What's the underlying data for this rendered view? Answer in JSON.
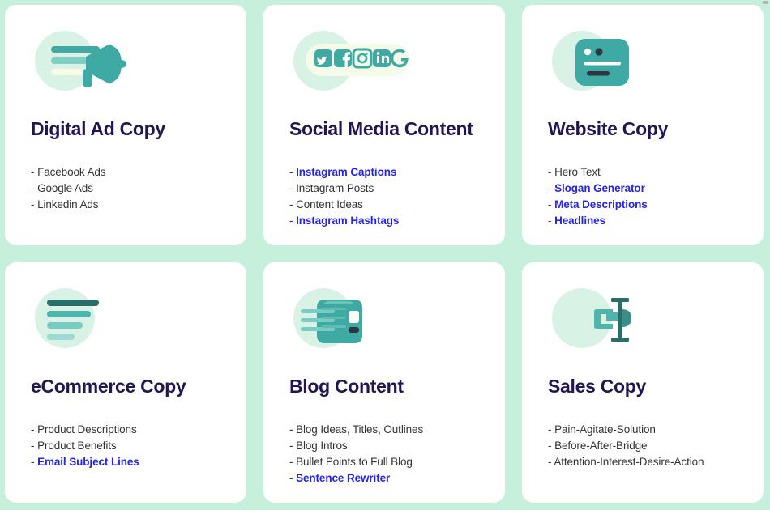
{
  "theme": {
    "background": "#c6f0dc",
    "card_background": "#ffffff",
    "title_color": "#231553",
    "text_color": "#333333",
    "link_color": "#2424ec",
    "icon_teal": "#3faaa4",
    "icon_teal_light": "#7fcfc6",
    "icon_teal_dark": "#2b6d68",
    "icon_blob": "#d8f2e6"
  },
  "cards": [
    {
      "id": "digital-ad-copy",
      "icon": "megaphone-icon",
      "title": "Digital Ad Copy",
      "items": [
        {
          "dash": "-",
          "label": "Facebook Ads",
          "link": false
        },
        {
          "dash": "-",
          "label": "Google Ads",
          "link": false
        },
        {
          "dash": "-",
          "label": "Linkedin Ads",
          "link": false
        }
      ]
    },
    {
      "id": "social-media-content",
      "icon": "social-networks-icon",
      "title": "Social Media Content",
      "social_icons": [
        "twitter-icon",
        "facebook-icon",
        "instagram-icon",
        "linkedin-icon",
        "google-icon"
      ],
      "items": [
        {
          "dash": "-",
          "label": "Instagram Captions",
          "link": true
        },
        {
          "dash": "-",
          "label": "Instagram Posts",
          "link": false
        },
        {
          "dash": "-",
          "label": "Content Ideas",
          "link": false
        },
        {
          "dash": "-",
          "label": "Instagram Hashtags",
          "link": true
        }
      ]
    },
    {
      "id": "website-copy",
      "icon": "browser-window-icon",
      "title": "Website Copy",
      "items": [
        {
          "dash": "-",
          "label": "Hero Text",
          "link": false
        },
        {
          "dash": "-",
          "label": "Slogan Generator",
          "link": true
        },
        {
          "dash": "-",
          "label": "Meta Descriptions",
          "link": true
        },
        {
          "dash": "-",
          "label": "Headlines",
          "link": true
        }
      ]
    },
    {
      "id": "ecommerce-copy",
      "icon": "text-lines-icon",
      "title": "eCommerce Copy",
      "items": [
        {
          "dash": "-",
          "label": "Product Descriptions",
          "link": false
        },
        {
          "dash": "-",
          "label": "Product Benefits",
          "link": false
        },
        {
          "dash": "-",
          "label": "Email Subject Lines",
          "link": true
        }
      ]
    },
    {
      "id": "blog-content",
      "icon": "article-card-icon",
      "title": "Blog Content",
      "items": [
        {
          "dash": "-",
          "label": "Blog Ideas, Titles, Outlines",
          "link": false
        },
        {
          "dash": "-",
          "label": "Blog Intros",
          "link": false
        },
        {
          "dash": "-",
          "label": "Bullet Points to Full Blog",
          "link": false
        },
        {
          "dash": "-",
          "label": "Sentence Rewriter",
          "link": true
        }
      ]
    },
    {
      "id": "sales-copy",
      "icon": "sales-funnel-icon",
      "title": "Sales Copy",
      "items": [
        {
          "dash": "-",
          "label": "Pain-Agitate-Solution",
          "link": false
        },
        {
          "dash": "-",
          "label": "Before-After-Bridge",
          "link": false
        },
        {
          "dash": "-",
          "label": "Attention-Interest-Desire-Action",
          "link": false
        }
      ]
    }
  ]
}
